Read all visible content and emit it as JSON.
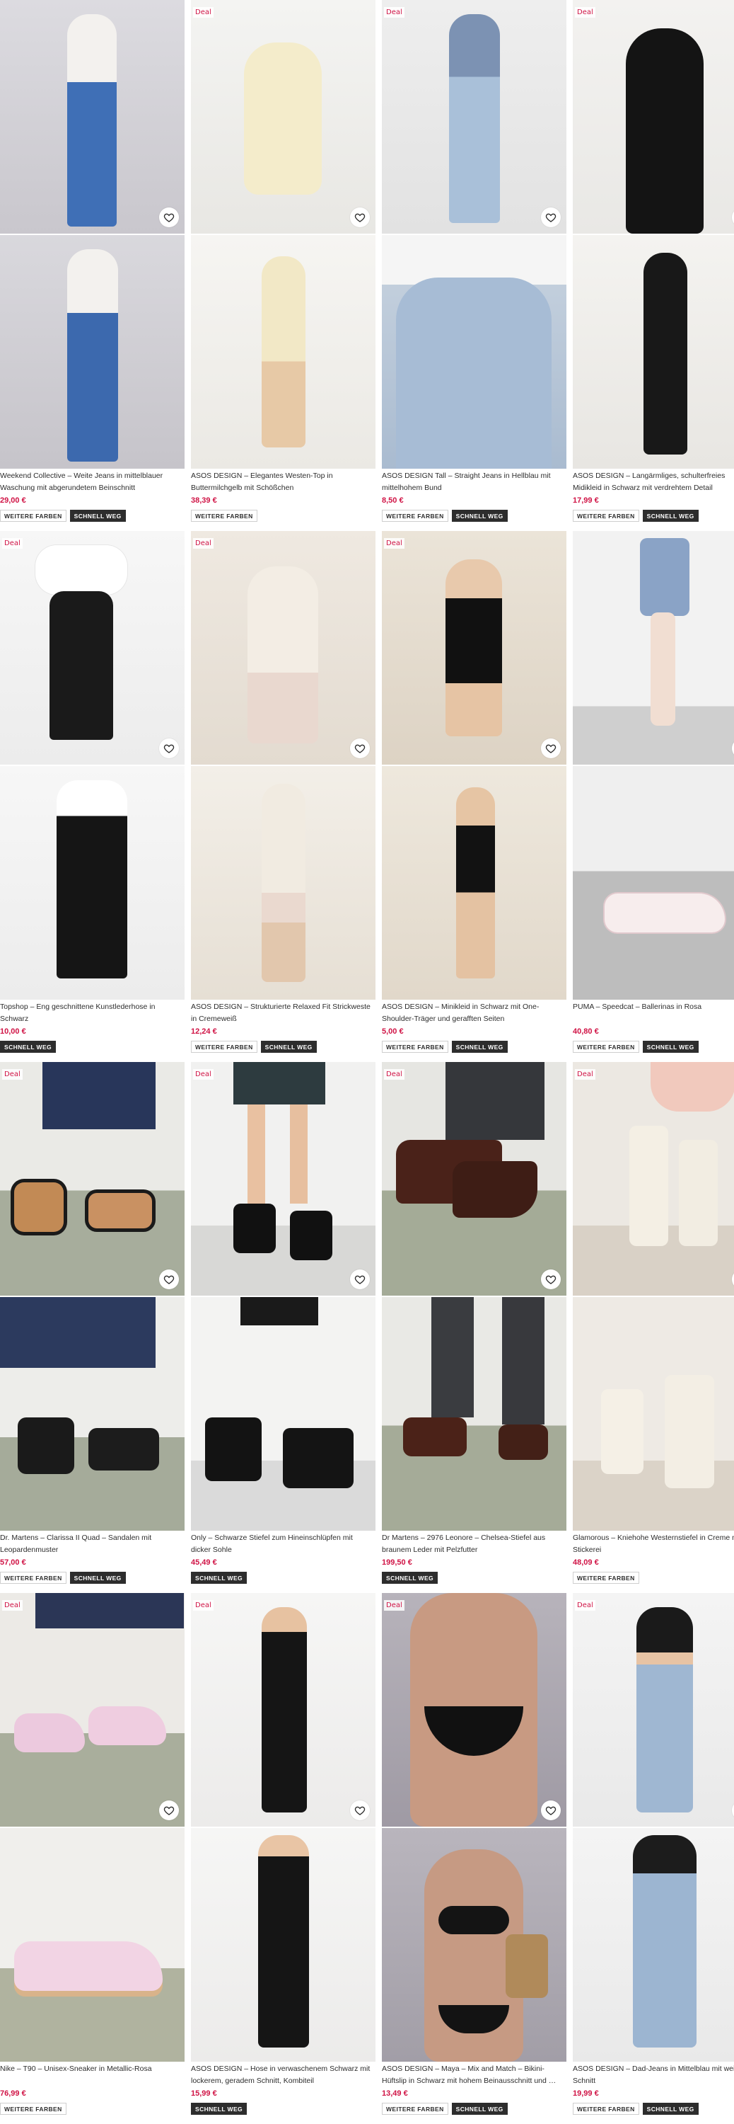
{
  "labels": {
    "deal": "Deal",
    "more_colors": "WEITERE FARBEN",
    "fast": "SCHNELL WEG"
  },
  "colors": {
    "price": "#d01345",
    "badge_dark": "#2d2d2d"
  },
  "icons": {
    "wishlist": "heart-outline-icon"
  },
  "products": [
    {
      "title": "Weekend Collective – Weite Jeans in mittelblauer Waschung mit abgerundetem Beinschnitt",
      "price": "29,00 €",
      "deal": false,
      "more_colors": true,
      "fast": true
    },
    {
      "title": "ASOS DESIGN – Elegantes Westen-Top in Buttermilchgelb mit Schößchen",
      "price": "38,39 €",
      "deal": true,
      "more_colors": true,
      "fast": false
    },
    {
      "title": "ASOS DESIGN Tall – Straight Jeans in Hellblau mit mittelhohem Bund",
      "price": "8,50 €",
      "deal": true,
      "more_colors": true,
      "fast": true
    },
    {
      "title": "ASOS DESIGN – Langärmliges, schulterfreies Midikleid in Schwarz mit verdrehtem Detail",
      "price": "17,99 €",
      "deal": true,
      "more_colors": true,
      "fast": true
    },
    {
      "title": "Topshop – Eng geschnittene Kunstlederhose in Schwarz",
      "price": "10,00 €",
      "deal": true,
      "more_colors": false,
      "fast": true
    },
    {
      "title": "ASOS DESIGN – Strukturierte Relaxed Fit Strickweste in Cremeweiß",
      "price": "12,24 €",
      "deal": true,
      "more_colors": true,
      "fast": true
    },
    {
      "title": "ASOS DESIGN – Minikleid in Schwarz mit One-Shoulder-Träger und gerafften Seiten",
      "price": "5,00 €",
      "deal": true,
      "more_colors": true,
      "fast": true
    },
    {
      "title": "PUMA – Speedcat – Ballerinas in Rosa",
      "price": "40,80 €",
      "deal": false,
      "more_colors": true,
      "fast": true
    },
    {
      "title": "Dr. Martens – Clarissa II Quad – Sandalen mit Leopardenmuster",
      "price": "57,00 €",
      "deal": true,
      "more_colors": true,
      "fast": true
    },
    {
      "title": "Only – Schwarze Stiefel zum Hineinschlüpfen mit dicker Sohle",
      "price": "45,49 €",
      "deal": true,
      "more_colors": false,
      "fast": true
    },
    {
      "title": "Dr Martens – 2976 Leonore – Chelsea-Stiefel aus braunem Leder mit Pelzfutter",
      "price": "199,50 €",
      "deal": true,
      "more_colors": false,
      "fast": true
    },
    {
      "title": "Glamorous – Kniehohe Westernstiefel in Creme mit Stickerei",
      "price": "48,09 €",
      "deal": true,
      "more_colors": true,
      "fast": false
    },
    {
      "title": "Nike – T90 – Unisex-Sneaker in Metallic-Rosa",
      "price": "76,99 €",
      "deal": true,
      "more_colors": true,
      "fast": false
    },
    {
      "title": "ASOS DESIGN – Hose in verwaschenem Schwarz mit lockerem, geradem Schnitt, Kombiteil",
      "price": "15,99 €",
      "deal": true,
      "more_colors": false,
      "fast": true
    },
    {
      "title": "ASOS DESIGN – Maya – Mix and Match – Bikini-Hüftslip in Schwarz mit hohem Beinausschnitt und …",
      "price": "13,49 €",
      "deal": true,
      "more_colors": true,
      "fast": true
    },
    {
      "title": "ASOS DESIGN – Dad-Jeans in Mittelblau mit weitem Schnitt",
      "price": "19,99 €",
      "deal": true,
      "more_colors": true,
      "fast": true
    }
  ]
}
